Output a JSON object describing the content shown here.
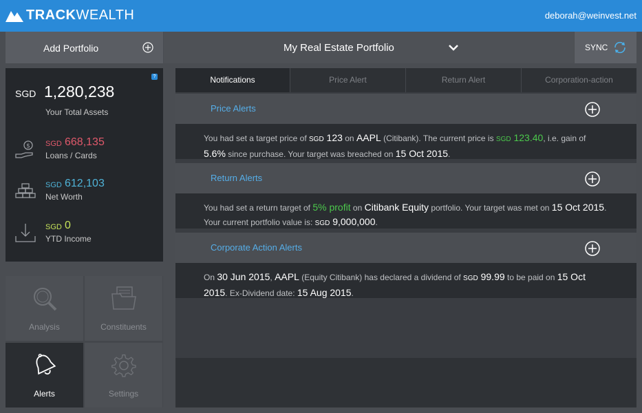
{
  "app": {
    "logo_bold": "TRACK",
    "logo_light": "WEALTH",
    "user_email": "deborah@weinvest.net"
  },
  "toolbar": {
    "add_portfolio": "Add Portfolio",
    "portfolio_name": "My Real Estate Portfolio",
    "sync_label": "SYNC"
  },
  "assets": {
    "help_badge": "?",
    "currency": "SGD",
    "total_value": "1,280,238",
    "total_label": "Your Total Assets",
    "stats": [
      {
        "currency": "SGD",
        "value": "668,135",
        "label": "Loans / Cards",
        "color": "#e0596b",
        "icon": "money-hand-icon"
      },
      {
        "currency": "SGD",
        "value": "612,103",
        "label": "Net Worth",
        "color": "#4fb3d8",
        "icon": "gold-bars-icon"
      },
      {
        "currency": "SGD",
        "value": "0",
        "label": "YTD Income",
        "color": "#c6e35a",
        "icon": "download-tray-icon"
      }
    ]
  },
  "nav": {
    "analysis": "Analysis",
    "constituents": "Constituents",
    "alerts": "Alerts",
    "settings": "Settings"
  },
  "tabs": [
    "Notifications",
    "Price Alert",
    "Return Alert",
    "Corporation-action"
  ],
  "alerts": {
    "price": {
      "title": "Price Alerts",
      "t1": "You had set a target price of ",
      "cur1": "SGD",
      "target": " 123",
      "t2": " on ",
      "ticker": "AAPL",
      "t3": " (Citibank). The current price is ",
      "cur2": "SGD",
      "current": " 123.40",
      "t4": ", i.e. gain of ",
      "gain": "5.6%",
      "t5": " since purchase. Your target was breached on ",
      "date": "15 Oct 2015",
      "t6": "."
    },
    "return": {
      "title": "Return Alerts",
      "t1": "You had set a return target of ",
      "target": "5% profit",
      "t2": " on ",
      "portfolio": "Citibank Equity",
      "t3": " portfolio. Your target was met on ",
      "date": "15 Oct 2015",
      "t4": ". Your current portfolio value is: ",
      "cur": "SGD",
      "value": " 9,000,000",
      "t5": "."
    },
    "corporate": {
      "title": "Corporate Action Alerts",
      "t1": "On ",
      "date1": "30 Jun 2015",
      "t2": ", ",
      "ticker": "AAPL",
      "t3": " (Equity Citibank) has declared a dividend of ",
      "cur": "SGD",
      "amount": " 99.99",
      "t4": " to be paid on ",
      "date2": "15 Oct 2015",
      "t5": ". Ex-Dividend date: ",
      "date3": "15 Aug 2015",
      "t6": "."
    }
  },
  "colors": {
    "header_blue": "#2a8ad8",
    "link_blue": "#56aee8",
    "gain_green": "#4cc94c"
  }
}
